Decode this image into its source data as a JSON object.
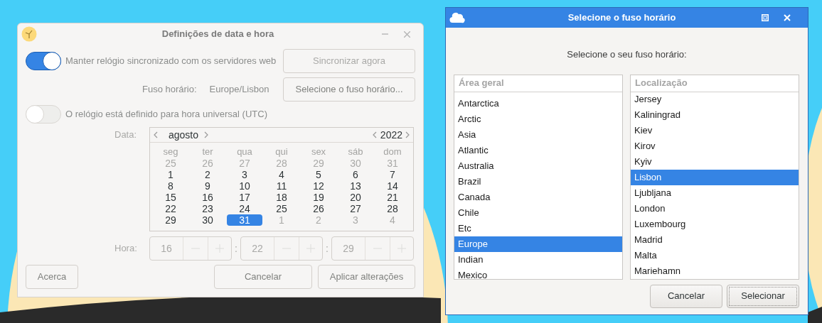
{
  "settings_window": {
    "title": "Definições de data e hora",
    "sync": {
      "label": "Manter relógio sincronizado com os servidores web",
      "on": true
    },
    "sync_button": {
      "label": "Sincronizar agora",
      "disabled": true
    },
    "timezone": {
      "label": "Fuso horário:",
      "value": "Europe/Lisbon",
      "button": "Selecione o fuso horário..."
    },
    "utc": {
      "label": "O relógio está definido para hora universal (UTC)",
      "on": false
    },
    "date": {
      "label": "Data:",
      "month": "agosto",
      "year": "2022",
      "weekdays": [
        "seg",
        "ter",
        "qua",
        "qui",
        "sex",
        "sáb",
        "dom"
      ],
      "days": [
        {
          "text": "25",
          "outside": true,
          "selected": false
        },
        {
          "text": "26",
          "outside": true,
          "selected": false
        },
        {
          "text": "27",
          "outside": true,
          "selected": false
        },
        {
          "text": "28",
          "outside": true,
          "selected": false
        },
        {
          "text": "29",
          "outside": true,
          "selected": false
        },
        {
          "text": "30",
          "outside": true,
          "selected": false
        },
        {
          "text": "31",
          "outside": true,
          "selected": false
        },
        {
          "text": "1",
          "outside": false,
          "selected": false
        },
        {
          "text": "2",
          "outside": false,
          "selected": false
        },
        {
          "text": "3",
          "outside": false,
          "selected": false
        },
        {
          "text": "4",
          "outside": false,
          "selected": false
        },
        {
          "text": "5",
          "outside": false,
          "selected": false
        },
        {
          "text": "6",
          "outside": false,
          "selected": false
        },
        {
          "text": "7",
          "outside": false,
          "selected": false
        },
        {
          "text": "8",
          "outside": false,
          "selected": false
        },
        {
          "text": "9",
          "outside": false,
          "selected": false
        },
        {
          "text": "10",
          "outside": false,
          "selected": false
        },
        {
          "text": "11",
          "outside": false,
          "selected": false
        },
        {
          "text": "12",
          "outside": false,
          "selected": false
        },
        {
          "text": "13",
          "outside": false,
          "selected": false
        },
        {
          "text": "14",
          "outside": false,
          "selected": false
        },
        {
          "text": "15",
          "outside": false,
          "selected": false
        },
        {
          "text": "16",
          "outside": false,
          "selected": false
        },
        {
          "text": "17",
          "outside": false,
          "selected": false
        },
        {
          "text": "18",
          "outside": false,
          "selected": false
        },
        {
          "text": "19",
          "outside": false,
          "selected": false
        },
        {
          "text": "20",
          "outside": false,
          "selected": false
        },
        {
          "text": "21",
          "outside": false,
          "selected": false
        },
        {
          "text": "22",
          "outside": false,
          "selected": false
        },
        {
          "text": "23",
          "outside": false,
          "selected": false
        },
        {
          "text": "24",
          "outside": false,
          "selected": false
        },
        {
          "text": "25",
          "outside": false,
          "selected": false
        },
        {
          "text": "26",
          "outside": false,
          "selected": false
        },
        {
          "text": "27",
          "outside": false,
          "selected": false
        },
        {
          "text": "28",
          "outside": false,
          "selected": false
        },
        {
          "text": "29",
          "outside": false,
          "selected": false
        },
        {
          "text": "30",
          "outside": false,
          "selected": false
        },
        {
          "text": "31",
          "outside": false,
          "selected": true
        },
        {
          "text": "1",
          "outside": true,
          "selected": false
        },
        {
          "text": "2",
          "outside": true,
          "selected": false
        },
        {
          "text": "3",
          "outside": true,
          "selected": false
        },
        {
          "text": "4",
          "outside": true,
          "selected": false
        }
      ]
    },
    "time": {
      "label": "Hora:",
      "fields": [
        "16",
        "22",
        "29"
      ],
      "separators": [
        ":",
        ":"
      ]
    },
    "buttons": [
      {
        "label": "Acerca",
        "kind": "left"
      },
      {
        "label": "Cancelar",
        "kind": "right"
      },
      {
        "label": "Aplicar alterações",
        "kind": "right"
      }
    ]
  },
  "timezone_dialog": {
    "title": "Selecione o fuso horário",
    "prompt": "Selecione o seu fuso horário:",
    "areas": {
      "header": "Área geral",
      "items": [
        {
          "label": "Antarctica",
          "selected": false
        },
        {
          "label": "Arctic",
          "selected": false
        },
        {
          "label": "Asia",
          "selected": false
        },
        {
          "label": "Atlantic",
          "selected": false
        },
        {
          "label": "Australia",
          "selected": false
        },
        {
          "label": "Brazil",
          "selected": false
        },
        {
          "label": "Canada",
          "selected": false
        },
        {
          "label": "Chile",
          "selected": false
        },
        {
          "label": "Etc",
          "selected": false
        },
        {
          "label": "Europe",
          "selected": true
        },
        {
          "label": "Indian",
          "selected": false
        },
        {
          "label": "Mexico",
          "selected": false
        }
      ]
    },
    "locations": {
      "header": "Localização",
      "items": [
        {
          "label": "Jersey",
          "selected": false
        },
        {
          "label": "Kaliningrad",
          "selected": false
        },
        {
          "label": "Kiev",
          "selected": false
        },
        {
          "label": "Kirov",
          "selected": false
        },
        {
          "label": "Kyiv",
          "selected": false
        },
        {
          "label": "Lisbon",
          "selected": true
        },
        {
          "label": "Ljubljana",
          "selected": false
        },
        {
          "label": "London",
          "selected": false
        },
        {
          "label": "Luxembourg",
          "selected": false
        },
        {
          "label": "Madrid",
          "selected": false
        },
        {
          "label": "Malta",
          "selected": false
        },
        {
          "label": "Mariehamn",
          "selected": false
        }
      ]
    },
    "buttons": [
      {
        "label": "Cancelar",
        "focused": false
      },
      {
        "label": "Selecionar",
        "focused": true
      }
    ]
  }
}
